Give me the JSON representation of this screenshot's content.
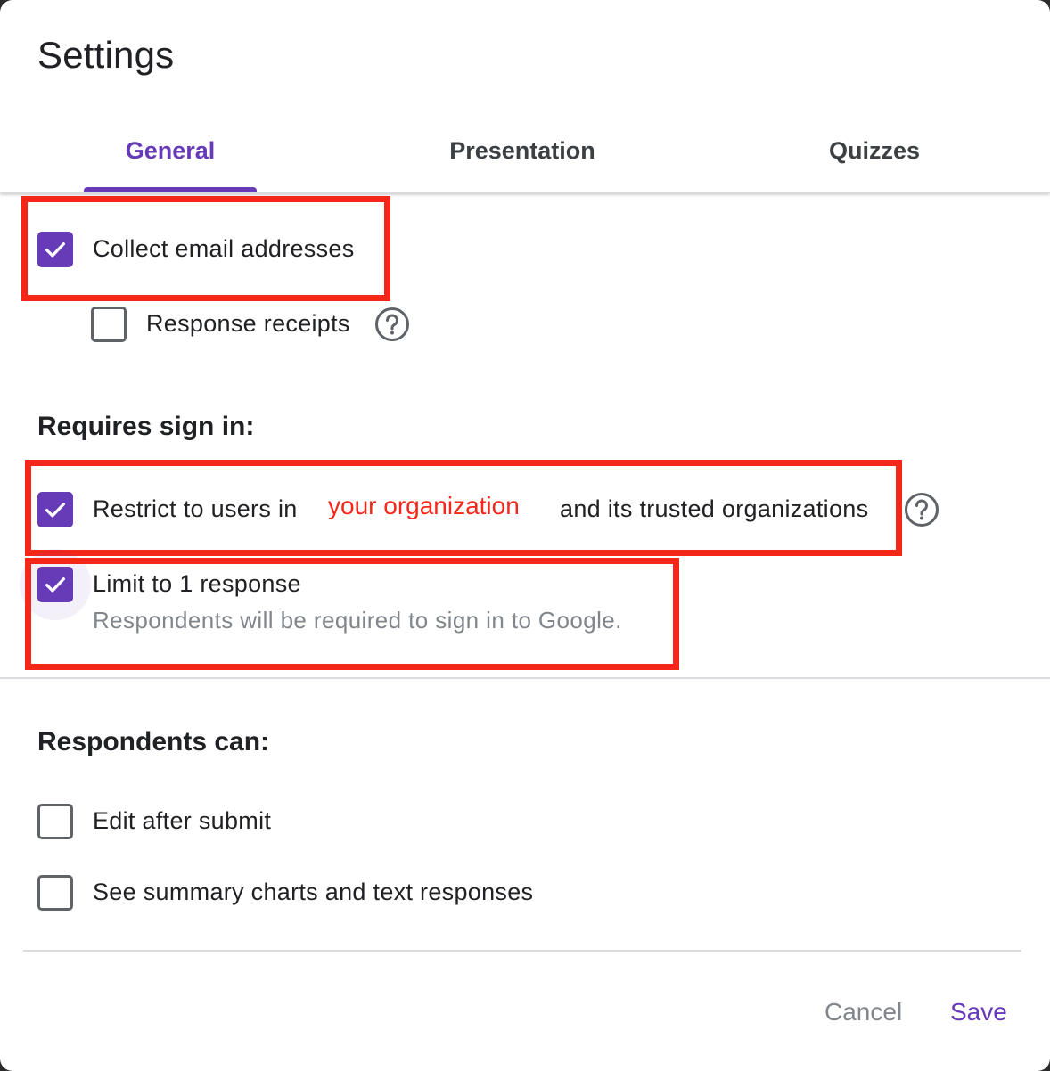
{
  "dialog": {
    "title": "Settings"
  },
  "tabs": [
    {
      "label": "General",
      "active": true
    },
    {
      "label": "Presentation",
      "active": false
    },
    {
      "label": "Quizzes",
      "active": false
    }
  ],
  "general": {
    "collect_email": {
      "label": "Collect email addresses",
      "checked": true
    },
    "response_receipts": {
      "label": "Response receipts",
      "checked": false,
      "icon": "help-icon"
    },
    "requires_sign_in": {
      "heading": "Requires sign in:",
      "restrict": {
        "label_prefix": "Restrict to users in",
        "label_suffix": "and its trusted organizations",
        "checked": true,
        "icon": "help-icon"
      },
      "limit": {
        "label": "Limit to 1 response",
        "sublabel": "Respondents will be required to sign in to Google.",
        "checked": true
      }
    },
    "respondents_can": {
      "heading": "Respondents can:",
      "edit_after_submit": {
        "label": "Edit after submit",
        "checked": false
      },
      "see_summary": {
        "label": "See summary charts and text responses",
        "checked": false
      }
    }
  },
  "annotation": {
    "text": "your organization"
  },
  "footer": {
    "cancel_label": "Cancel",
    "save_label": "Save"
  },
  "colors": {
    "accent": "#673ab7",
    "annotation": "#f5271a",
    "text": "#202124",
    "muted": "#80868b"
  }
}
